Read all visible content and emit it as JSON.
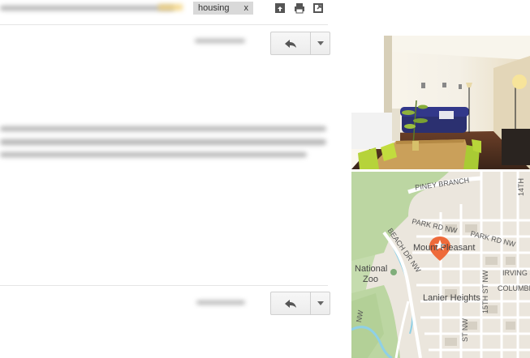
{
  "thread": {
    "label_chip": "housing",
    "label_remove": "x"
  },
  "toolbar_icons": [
    "archive-to-top-icon",
    "print-icon",
    "open-in-new-window-icon"
  ],
  "map": {
    "streets": {
      "piney_branch": "PINEY BRANCH",
      "park_rd_1": "PARK RD NW",
      "park_rd_2": "PARK RD NW",
      "beach_dr": "BEACH DR NW",
      "irving": "IRVING S",
      "columbia": "COLUMBIA",
      "rock_creek": "ROCK CREEK",
      "sixteenth": "14TH",
      "fifteenth": "15TH ST NW",
      "fourteenth": "14TH",
      "nw_ave": "NW",
      "st_nw": "ST NW"
    },
    "places": {
      "mount_pleasant": "Mount Pleasant",
      "national_zoo_1": "National",
      "national_zoo_2": "Zoo",
      "lanier_heights": "Lanier Heights"
    },
    "colors": {
      "park": "#c5dcae",
      "water": "#8fd0e6",
      "road": "#ffffff",
      "pin": "#ee6a3a"
    }
  }
}
